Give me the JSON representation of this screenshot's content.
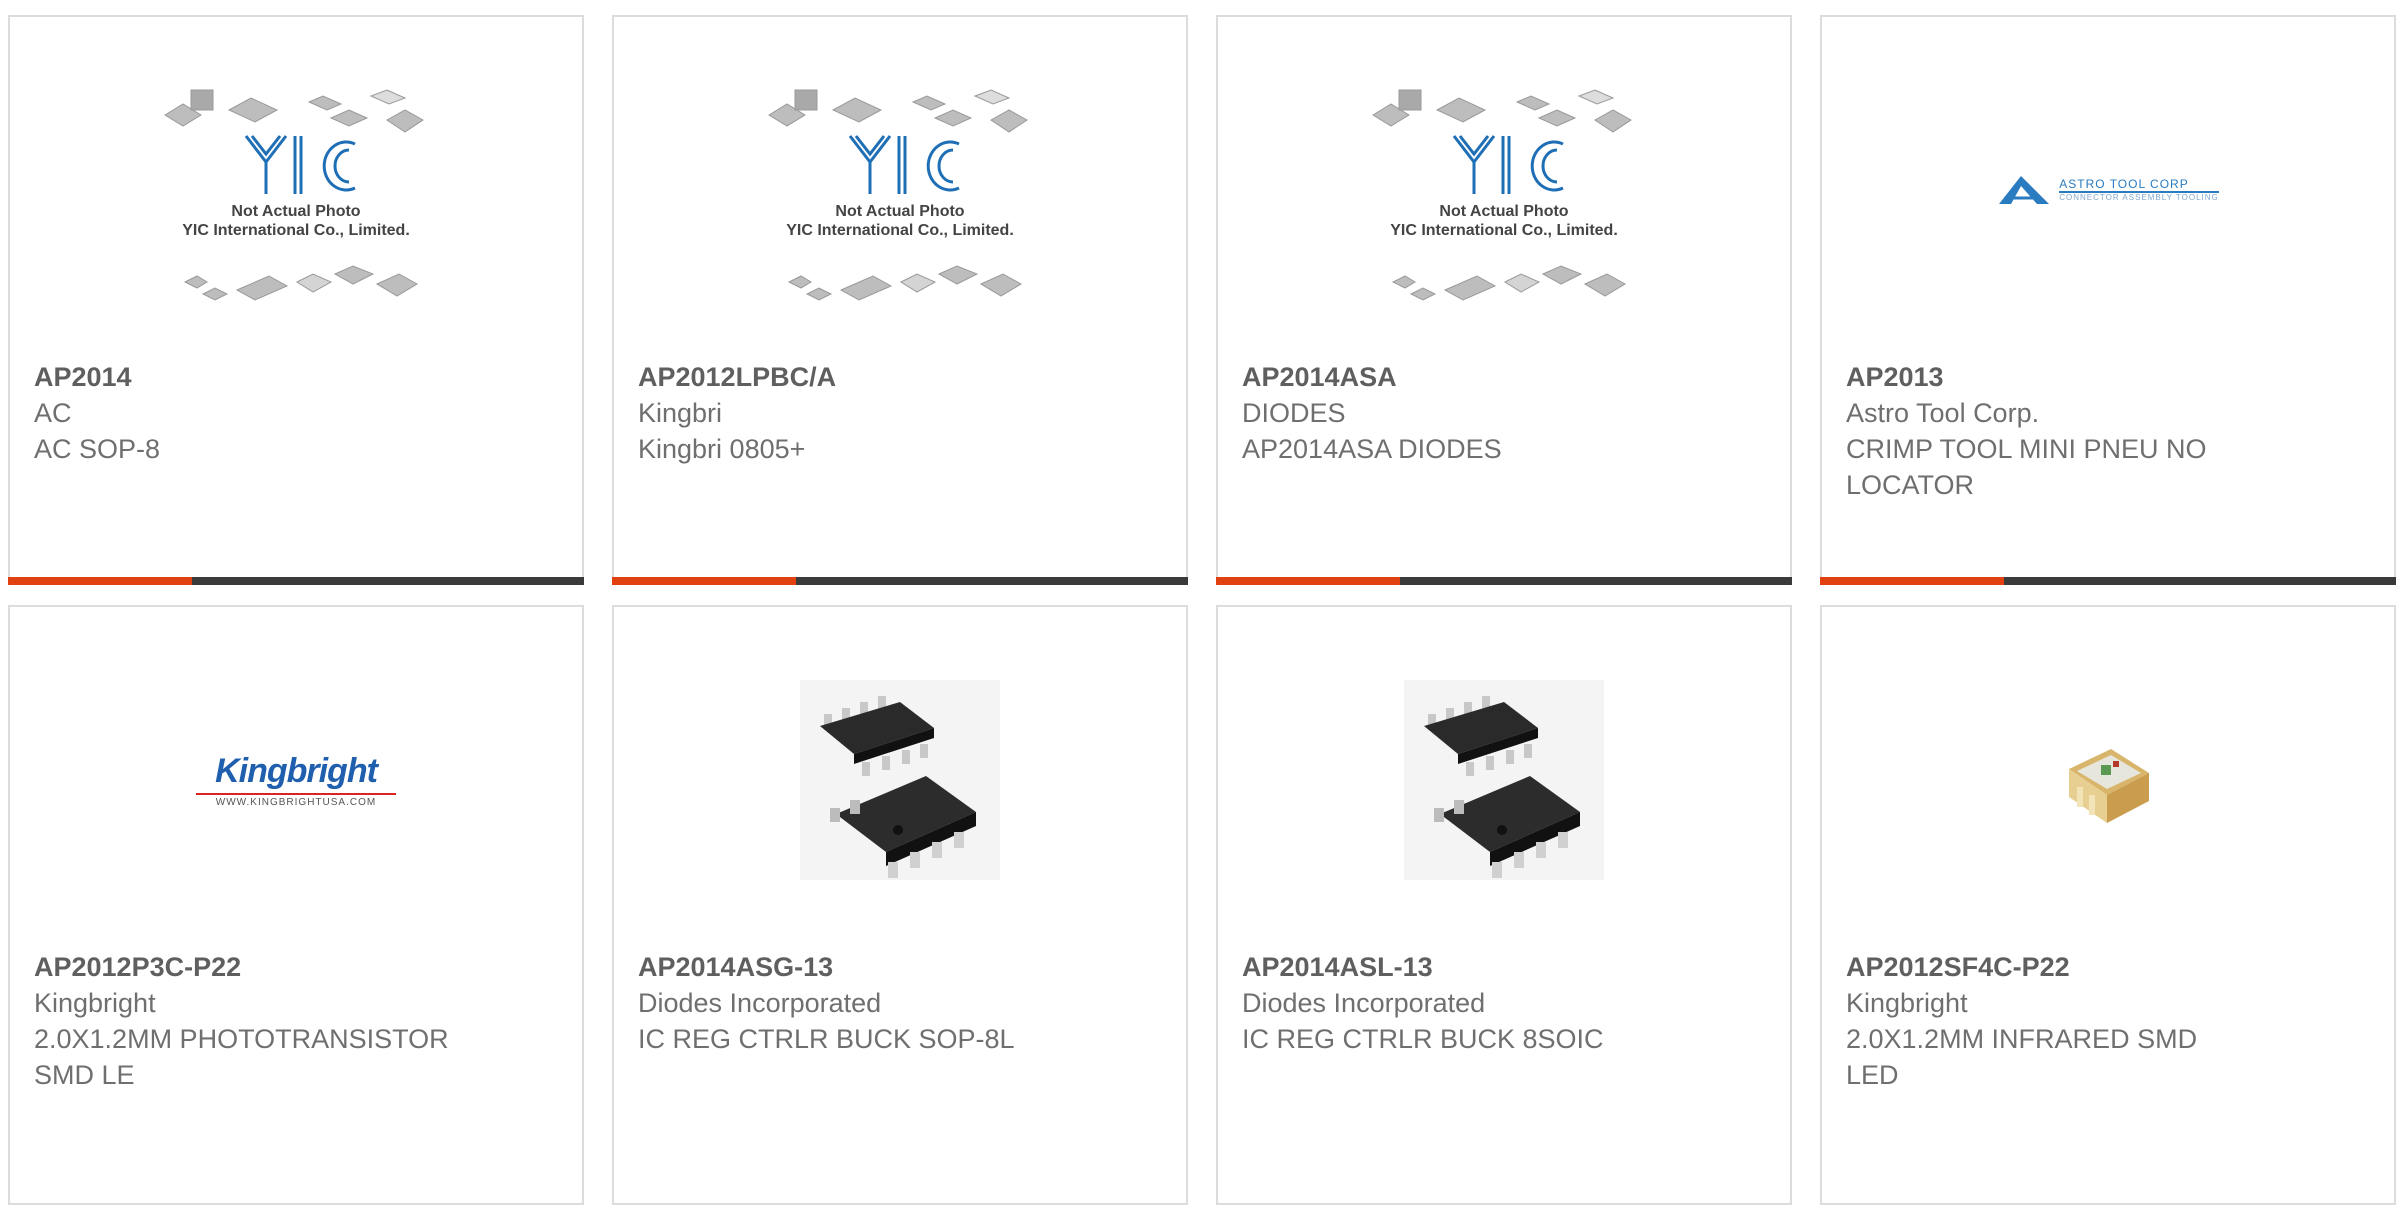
{
  "placeholder": {
    "line1": "Not Actual Photo",
    "line2": "YIC International Co., Limited."
  },
  "logos": {
    "astro": "ASTRO TOOL CORP",
    "astro_sub": "CONNECTOR ASSEMBLY TOOLING",
    "kingbright": "Kingbright",
    "kingbright_url": "WWW.KINGBRIGHTUSA.COM"
  },
  "colors": {
    "accent": "#e0410f",
    "bar": "#3a3a3a",
    "border": "#dcdcdc",
    "yic_blue": "#1e6fb5"
  },
  "products": [
    {
      "part": "AP2014",
      "maker": "AC",
      "desc": "AC SOP-8",
      "image": "yic-placeholder"
    },
    {
      "part": "AP2012LPBC/A",
      "maker": "Kingbri",
      "desc": "Kingbri 0805+",
      "image": "yic-placeholder"
    },
    {
      "part": "AP2014ASA",
      "maker": "DIODES",
      "desc": "AP2014ASA DIODES",
      "image": "yic-placeholder"
    },
    {
      "part": "AP2013",
      "maker": "Astro Tool Corp.",
      "desc": "CRIMP TOOL MINI PNEU NO LOCATOR",
      "image": "astro-logo"
    },
    {
      "part": "AP2012P3C-P22",
      "maker": "Kingbright",
      "desc": "2.0X1.2MM PHOTOTRANSISTOR SMD LE",
      "image": "kingbright-logo"
    },
    {
      "part": "AP2014ASG-13",
      "maker": "Diodes Incorporated",
      "desc": "IC REG CTRLR BUCK SOP-8L",
      "image": "sop8-chip"
    },
    {
      "part": "AP2014ASL-13",
      "maker": "Diodes Incorporated",
      "desc": "IC REG CTRLR BUCK 8SOIC",
      "image": "sop8-chip"
    },
    {
      "part": "AP2012SF4C-P22",
      "maker": "Kingbright",
      "desc": "2.0X1.2MM INFRARED SMD LED",
      "image": "smd-led"
    }
  ]
}
